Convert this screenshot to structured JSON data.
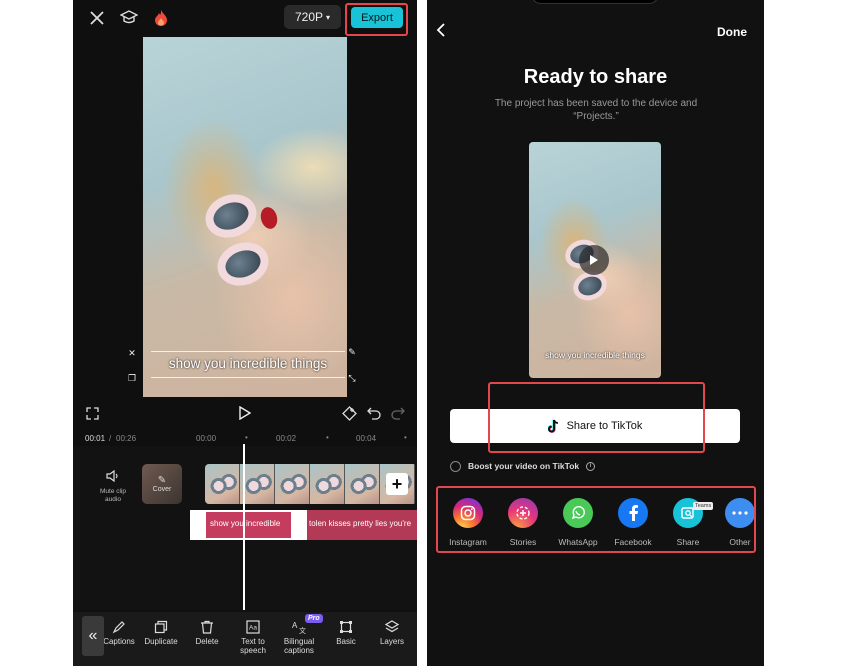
{
  "editor": {
    "resolution": "720P",
    "export_label": "Export",
    "caption_text": "show you incredible things",
    "timecode_current": "00:01",
    "timecode_sep": "/",
    "timecode_total": "00:26",
    "tick_1": "00:00",
    "tick_2": "00:02",
    "tick_3": "00:04",
    "mute_label": "Mute clip audio",
    "cover_label": "Cover",
    "caption_segment_1": "show you incredible",
    "caption_segment_2": "tolen kisses pretty lies you're",
    "tools": [
      {
        "label": "Captions"
      },
      {
        "label": "Duplicate"
      },
      {
        "label": "Delete"
      },
      {
        "label": "Text to speech"
      },
      {
        "label": "Bilingual captions"
      },
      {
        "label": "Basic"
      },
      {
        "label": "Layers"
      }
    ],
    "pro_badge": "Pro"
  },
  "share": {
    "done_label": "Done",
    "title": "Ready to share",
    "saved_message": "The project has been saved to the device and “Projects.”",
    "preview_caption": "show you incredible things",
    "tiktok_button": "Share to TikTok",
    "boost_label": "Boost your video on TikTok",
    "teams_badge": "Teams",
    "apps": [
      {
        "label": "Instagram",
        "icon": "instagram-icon"
      },
      {
        "label": "Stories",
        "icon": "stories-icon"
      },
      {
        "label": "WhatsApp",
        "icon": "whatsapp-icon"
      },
      {
        "label": "Facebook",
        "icon": "facebook-icon"
      },
      {
        "label": "Share",
        "icon": "share-icon"
      },
      {
        "label": "Other",
        "icon": "more-icon"
      }
    ]
  },
  "colors": {
    "accent": "#18c3d8",
    "highlight": "#e2474d",
    "caption_track": "#b23a56"
  }
}
